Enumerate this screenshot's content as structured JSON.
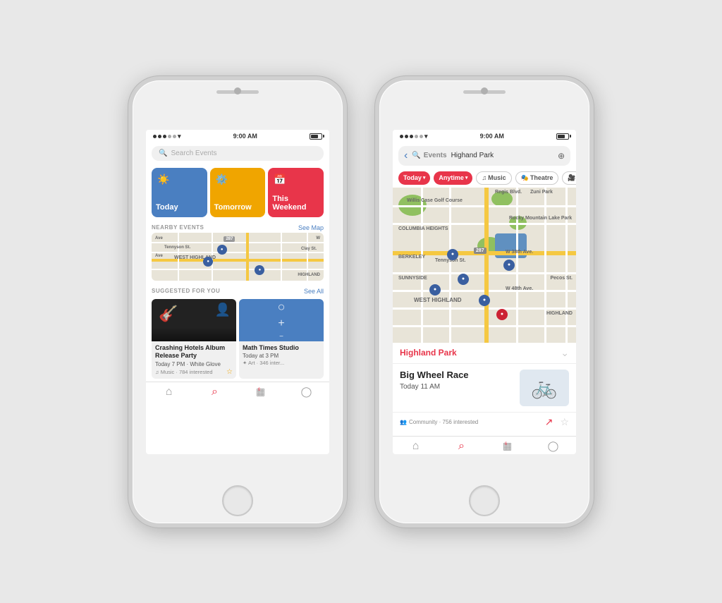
{
  "phone1": {
    "status": {
      "time": "9:00 AM",
      "signal_dots": 5,
      "wifi": "WiFi"
    },
    "search": {
      "placeholder": "Search Events"
    },
    "tiles": [
      {
        "label": "Today",
        "icon": "☀️",
        "color": "blue"
      },
      {
        "label": "Tomorrow",
        "icon": "⚙️",
        "color": "yellow"
      },
      {
        "label": "This Weekend",
        "icon": "📅",
        "color": "red"
      }
    ],
    "nearby": {
      "title": "NEARBY EVENTS",
      "link": "See Map"
    },
    "suggested": {
      "title": "SUGGESTED FOR YOU",
      "link": "See All"
    },
    "events": [
      {
        "title": "Crashing Hotels Album Release Party",
        "time": "Today 7 PM · White Glove",
        "meta": "♫ Music · 784 interested"
      },
      {
        "title": "Math Times Studio",
        "time": "Today at 3 PM",
        "meta": "✦ Art · 346 inter..."
      }
    ],
    "tabs": [
      {
        "icon": "⌂",
        "label": ""
      },
      {
        "icon": "⌕",
        "label": "",
        "active": true
      },
      {
        "icon": "▦",
        "label": ""
      },
      {
        "icon": "◯",
        "label": ""
      }
    ]
  },
  "phone2": {
    "status": {
      "time": "9:00 AM"
    },
    "search": {
      "placeholder": "Events",
      "location": "Highand Park"
    },
    "filters": [
      {
        "label": "Today",
        "type": "red",
        "caret": true
      },
      {
        "label": "Anytime",
        "type": "red",
        "caret": true
      },
      {
        "label": "♫ Music",
        "type": "outline"
      },
      {
        "label": "🎭 Theatre",
        "type": "outline"
      },
      {
        "label": "🎥",
        "type": "outline"
      }
    ],
    "location_section": {
      "name": "Highland Park",
      "expandable": true
    },
    "featured_event": {
      "title": "Big Wheel Race",
      "time": "Today 11 AM",
      "meta": "Community · 756 interested"
    }
  }
}
